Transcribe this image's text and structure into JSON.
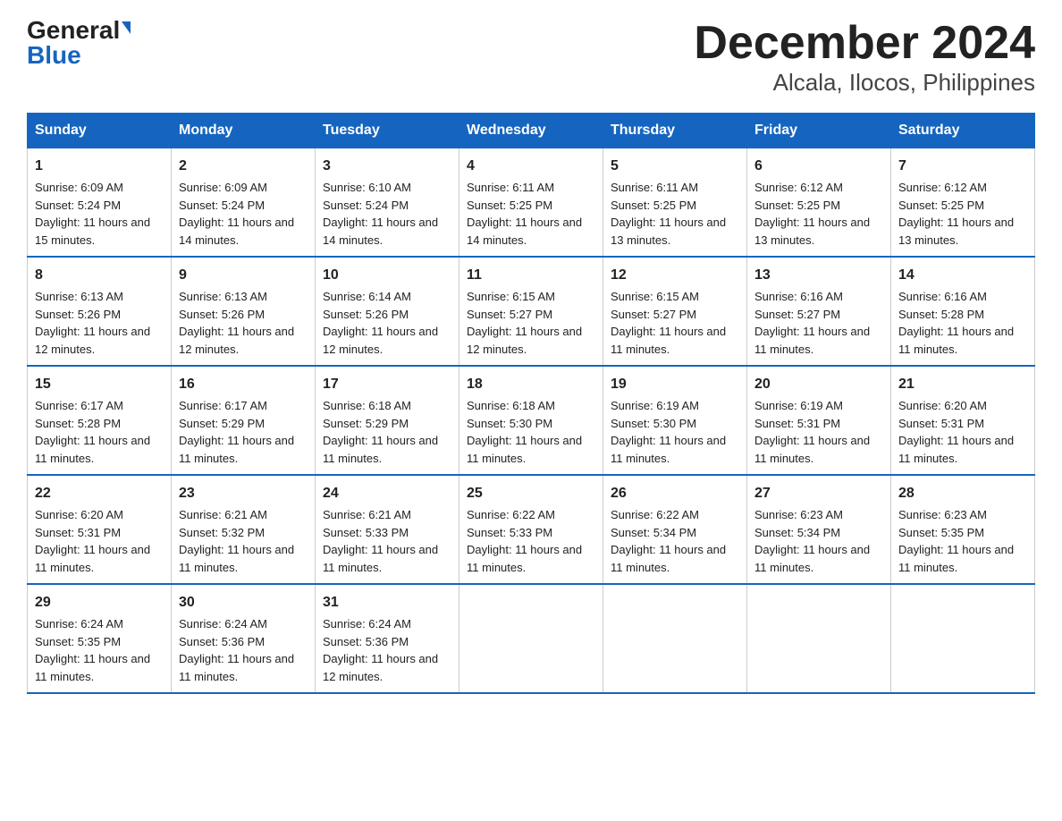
{
  "logo": {
    "general": "General",
    "blue": "Blue"
  },
  "title": "December 2024",
  "subtitle": "Alcala, Ilocos, Philippines",
  "weekdays": [
    "Sunday",
    "Monday",
    "Tuesday",
    "Wednesday",
    "Thursday",
    "Friday",
    "Saturday"
  ],
  "weeks": [
    [
      {
        "day": "1",
        "sunrise": "6:09 AM",
        "sunset": "5:24 PM",
        "daylight": "11 hours and 15 minutes."
      },
      {
        "day": "2",
        "sunrise": "6:09 AM",
        "sunset": "5:24 PM",
        "daylight": "11 hours and 14 minutes."
      },
      {
        "day": "3",
        "sunrise": "6:10 AM",
        "sunset": "5:24 PM",
        "daylight": "11 hours and 14 minutes."
      },
      {
        "day": "4",
        "sunrise": "6:11 AM",
        "sunset": "5:25 PM",
        "daylight": "11 hours and 14 minutes."
      },
      {
        "day": "5",
        "sunrise": "6:11 AM",
        "sunset": "5:25 PM",
        "daylight": "11 hours and 13 minutes."
      },
      {
        "day": "6",
        "sunrise": "6:12 AM",
        "sunset": "5:25 PM",
        "daylight": "11 hours and 13 minutes."
      },
      {
        "day": "7",
        "sunrise": "6:12 AM",
        "sunset": "5:25 PM",
        "daylight": "11 hours and 13 minutes."
      }
    ],
    [
      {
        "day": "8",
        "sunrise": "6:13 AM",
        "sunset": "5:26 PM",
        "daylight": "11 hours and 12 minutes."
      },
      {
        "day": "9",
        "sunrise": "6:13 AM",
        "sunset": "5:26 PM",
        "daylight": "11 hours and 12 minutes."
      },
      {
        "day": "10",
        "sunrise": "6:14 AM",
        "sunset": "5:26 PM",
        "daylight": "11 hours and 12 minutes."
      },
      {
        "day": "11",
        "sunrise": "6:15 AM",
        "sunset": "5:27 PM",
        "daylight": "11 hours and 12 minutes."
      },
      {
        "day": "12",
        "sunrise": "6:15 AM",
        "sunset": "5:27 PM",
        "daylight": "11 hours and 11 minutes."
      },
      {
        "day": "13",
        "sunrise": "6:16 AM",
        "sunset": "5:27 PM",
        "daylight": "11 hours and 11 minutes."
      },
      {
        "day": "14",
        "sunrise": "6:16 AM",
        "sunset": "5:28 PM",
        "daylight": "11 hours and 11 minutes."
      }
    ],
    [
      {
        "day": "15",
        "sunrise": "6:17 AM",
        "sunset": "5:28 PM",
        "daylight": "11 hours and 11 minutes."
      },
      {
        "day": "16",
        "sunrise": "6:17 AM",
        "sunset": "5:29 PM",
        "daylight": "11 hours and 11 minutes."
      },
      {
        "day": "17",
        "sunrise": "6:18 AM",
        "sunset": "5:29 PM",
        "daylight": "11 hours and 11 minutes."
      },
      {
        "day": "18",
        "sunrise": "6:18 AM",
        "sunset": "5:30 PM",
        "daylight": "11 hours and 11 minutes."
      },
      {
        "day": "19",
        "sunrise": "6:19 AM",
        "sunset": "5:30 PM",
        "daylight": "11 hours and 11 minutes."
      },
      {
        "day": "20",
        "sunrise": "6:19 AM",
        "sunset": "5:31 PM",
        "daylight": "11 hours and 11 minutes."
      },
      {
        "day": "21",
        "sunrise": "6:20 AM",
        "sunset": "5:31 PM",
        "daylight": "11 hours and 11 minutes."
      }
    ],
    [
      {
        "day": "22",
        "sunrise": "6:20 AM",
        "sunset": "5:31 PM",
        "daylight": "11 hours and 11 minutes."
      },
      {
        "day": "23",
        "sunrise": "6:21 AM",
        "sunset": "5:32 PM",
        "daylight": "11 hours and 11 minutes."
      },
      {
        "day": "24",
        "sunrise": "6:21 AM",
        "sunset": "5:33 PM",
        "daylight": "11 hours and 11 minutes."
      },
      {
        "day": "25",
        "sunrise": "6:22 AM",
        "sunset": "5:33 PM",
        "daylight": "11 hours and 11 minutes."
      },
      {
        "day": "26",
        "sunrise": "6:22 AM",
        "sunset": "5:34 PM",
        "daylight": "11 hours and 11 minutes."
      },
      {
        "day": "27",
        "sunrise": "6:23 AM",
        "sunset": "5:34 PM",
        "daylight": "11 hours and 11 minutes."
      },
      {
        "day": "28",
        "sunrise": "6:23 AM",
        "sunset": "5:35 PM",
        "daylight": "11 hours and 11 minutes."
      }
    ],
    [
      {
        "day": "29",
        "sunrise": "6:24 AM",
        "sunset": "5:35 PM",
        "daylight": "11 hours and 11 minutes."
      },
      {
        "day": "30",
        "sunrise": "6:24 AM",
        "sunset": "5:36 PM",
        "daylight": "11 hours and 11 minutes."
      },
      {
        "day": "31",
        "sunrise": "6:24 AM",
        "sunset": "5:36 PM",
        "daylight": "11 hours and 12 minutes."
      },
      null,
      null,
      null,
      null
    ]
  ]
}
